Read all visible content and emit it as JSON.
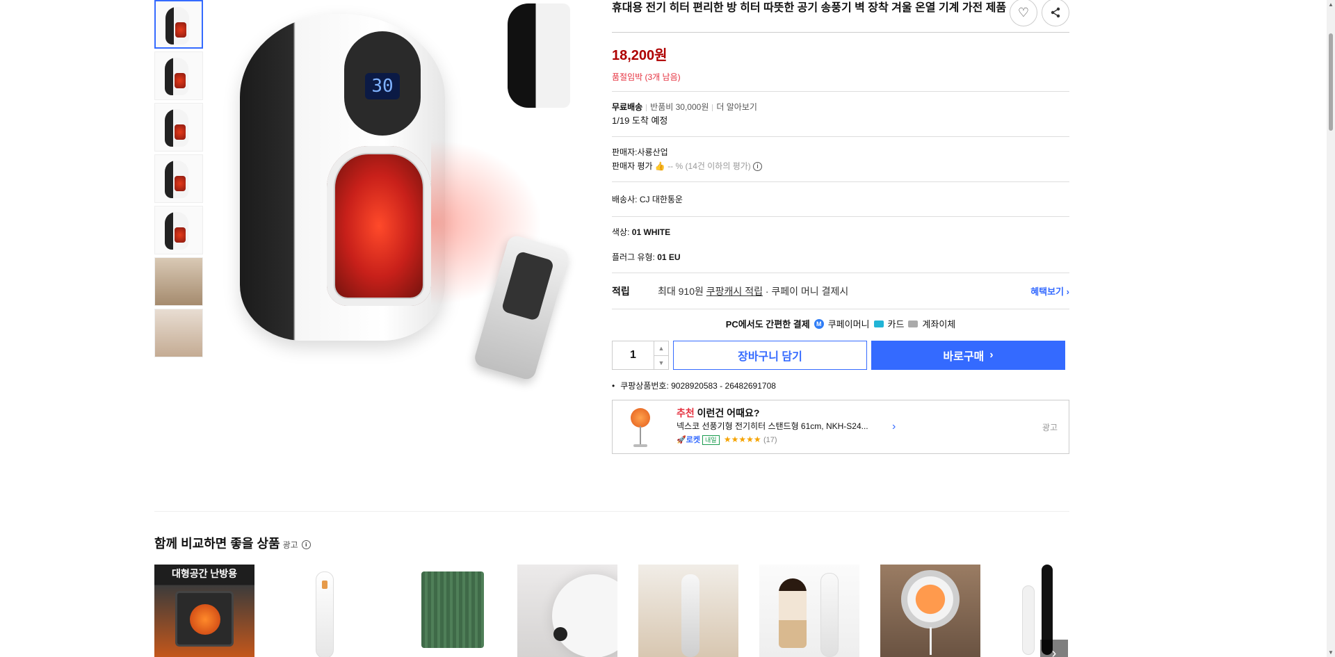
{
  "product": {
    "title": "휴대용 전기 히터 편리한 방 히터 따뜻한 공기 송풍기 벽 장착 겨울 온열 기계 가전 제품",
    "price": "18,200원",
    "stock_notice": "품절임박 (3개 남음)",
    "display_temp": "30"
  },
  "header_actions": {
    "like_icon": "heart-icon",
    "share_icon": "share-icon"
  },
  "shipping": {
    "free_label": "무료배송",
    "return_fee": "반품비 30,000원",
    "more": "더 알아보기",
    "arrival": "1/19 도착 예정"
  },
  "seller": {
    "name_label": "판매자:",
    "name": "사룡산업",
    "rating_label": "판매자 평가",
    "rating_value": "-- % (14건 이하의 평가)"
  },
  "delivery": {
    "label": "배송사:",
    "company": "CJ 대한통운"
  },
  "options": [
    {
      "label": "색상:",
      "value": "01 WHITE"
    },
    {
      "label": "플러그 유형:",
      "value": "01 EU"
    }
  ],
  "reward": {
    "label": "적립",
    "prefix": "최대 910원",
    "link": "쿠팡캐시 적립",
    "suffix": "· 쿠페이 머니 결제시",
    "benefit": "혜택보기 ›"
  },
  "payment": {
    "heading": "PC에서도 간편한 결제",
    "methods": [
      "쿠페이머니",
      "카드",
      "계좌이체"
    ],
    "badge": "M"
  },
  "purchase": {
    "qty": "1",
    "cart": "장바구니 담기",
    "buy": "바로구매",
    "buy_arrow": "›"
  },
  "product_number": "쿠팡상품번호: 9028920583 - 26482691708",
  "recommend": {
    "head_red": "추천",
    "head_rest": "이런건 어때요?",
    "name": "넥스코 선풍기형 전기히터 스탠드형 61cm, NKH-S24...",
    "rocket": "🚀로켓",
    "tomorrow": "내일",
    "stars": "★★★★★",
    "reviews": "(17)",
    "arrow": "›",
    "ad": "광고"
  },
  "compare": {
    "title": "함께 비교하면 좋을 상품",
    "ad": "광고",
    "info": "i",
    "first_banner": "대형공간 난방용",
    "next": "›"
  },
  "colors": {
    "accent": "#346aff",
    "price": "#ae0000",
    "stock": "#e5303e"
  }
}
